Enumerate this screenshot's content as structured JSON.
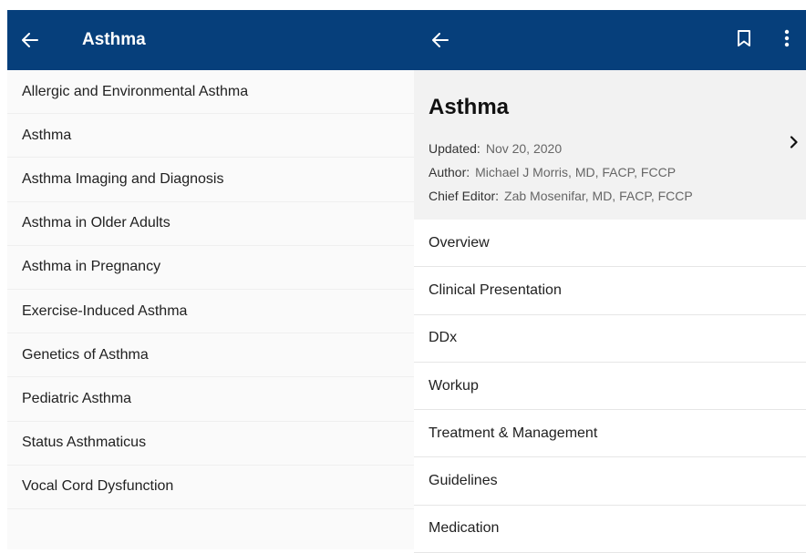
{
  "left": {
    "header_title": "Asthma",
    "items": [
      {
        "label": "Allergic and Environmental Asthma"
      },
      {
        "label": "Asthma"
      },
      {
        "label": "Asthma Imaging and Diagnosis"
      },
      {
        "label": "Asthma in Older Adults"
      },
      {
        "label": "Asthma in Pregnancy"
      },
      {
        "label": "Exercise-Induced Asthma"
      },
      {
        "label": "Genetics of Asthma"
      },
      {
        "label": "Pediatric Asthma"
      },
      {
        "label": "Status Asthmaticus"
      },
      {
        "label": "Vocal Cord Dysfunction"
      }
    ]
  },
  "right": {
    "article": {
      "title": "Asthma",
      "updated_label": "Updated:",
      "updated_value": "Nov 20, 2020",
      "author_label": "Author:",
      "author_value": "Michael J Morris, MD, FACP, FCCP",
      "editor_label": "Chief Editor:",
      "editor_value": "Zab Mosenifar, MD, FACP, FCCP"
    },
    "sections": [
      {
        "label": "Overview"
      },
      {
        "label": "Clinical Presentation"
      },
      {
        "label": "DDx"
      },
      {
        "label": "Workup"
      },
      {
        "label": "Treatment & Management"
      },
      {
        "label": "Guidelines"
      },
      {
        "label": "Medication"
      }
    ]
  },
  "icons": {
    "back": "back-arrow-icon",
    "bookmark": "bookmark-icon",
    "more": "more-vert-icon",
    "chevron": "chevron-right-icon"
  },
  "colors": {
    "header_bg": "#063f7b",
    "card_bg": "#f2f2f2",
    "list_bg": "#fafafa"
  }
}
